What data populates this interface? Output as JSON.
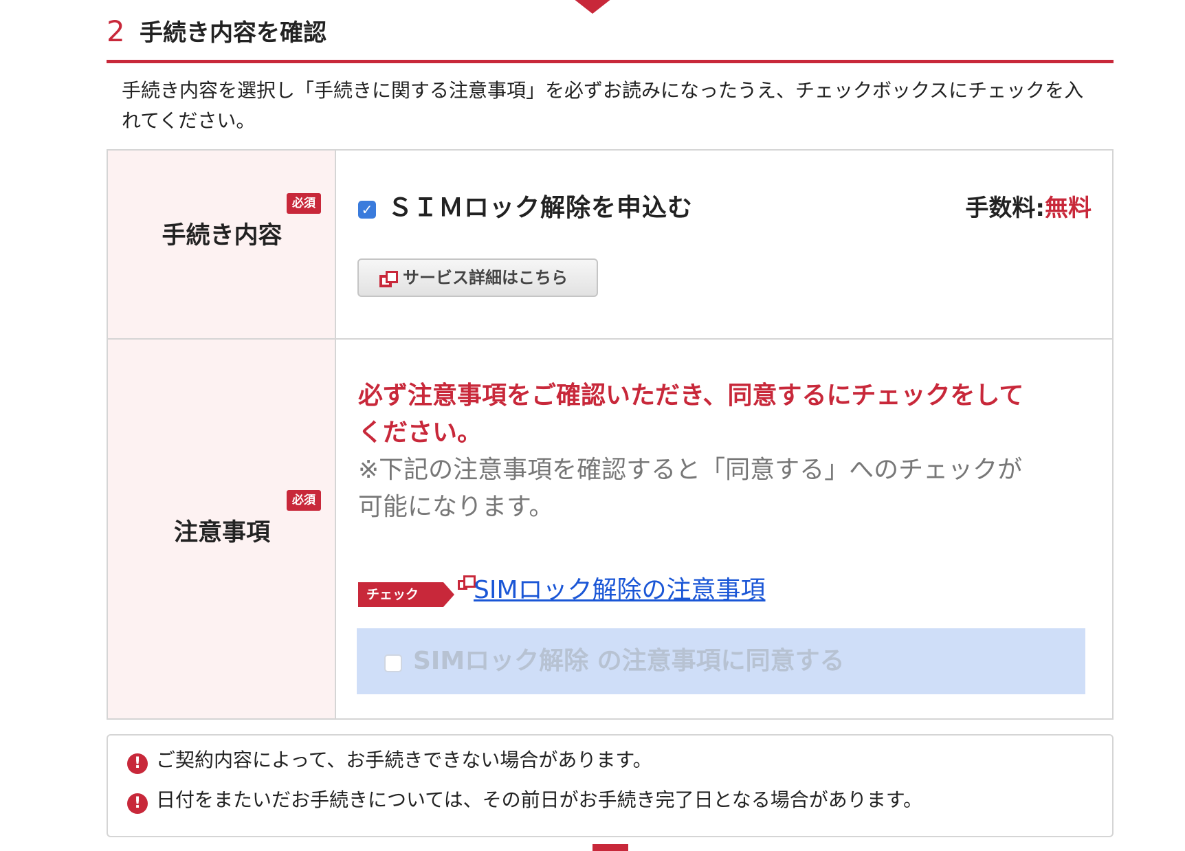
{
  "section": {
    "step_number": "2",
    "title": "手続き内容を確認",
    "intro": "手続き内容を選択し「手続きに関する注意事項」を必ずお読みになったうえ、チェックボックスにチェックを入れてください。"
  },
  "procedure": {
    "header": "手続き内容",
    "required_badge": "必須",
    "option_label": "ＳＩＭロック解除を申込む",
    "option_checked": true,
    "fee_label": "手数料:",
    "fee_value": "無料",
    "detail_button": "サービス詳細はこちら"
  },
  "notice": {
    "header": "注意事項",
    "required_badge": "必須",
    "warning": "必ず注意事項をご確認いただき、同意するにチェックをしてください。",
    "sub_note": "※下記の注意事項を確認すると「同意する」へのチェックが可能になります。",
    "check_tag": "チェック",
    "link_text": "SIMロック解除の注意事項",
    "agree_label": "SIMロック解除 の注意事項に同意する",
    "agree_checked": false,
    "agree_disabled": true
  },
  "notes": [
    "ご契約内容によって、お手続きできない場合があります。",
    "日付をまたいだお手続きについては、その前日がお手続き完了日となる場合があります。"
  ],
  "colors": {
    "accent": "#c8283a",
    "link": "#1a56d6",
    "checkbox": "#3a7bdc",
    "agree_bg": "#cfdef8",
    "header_bg": "#fdf2f2"
  }
}
